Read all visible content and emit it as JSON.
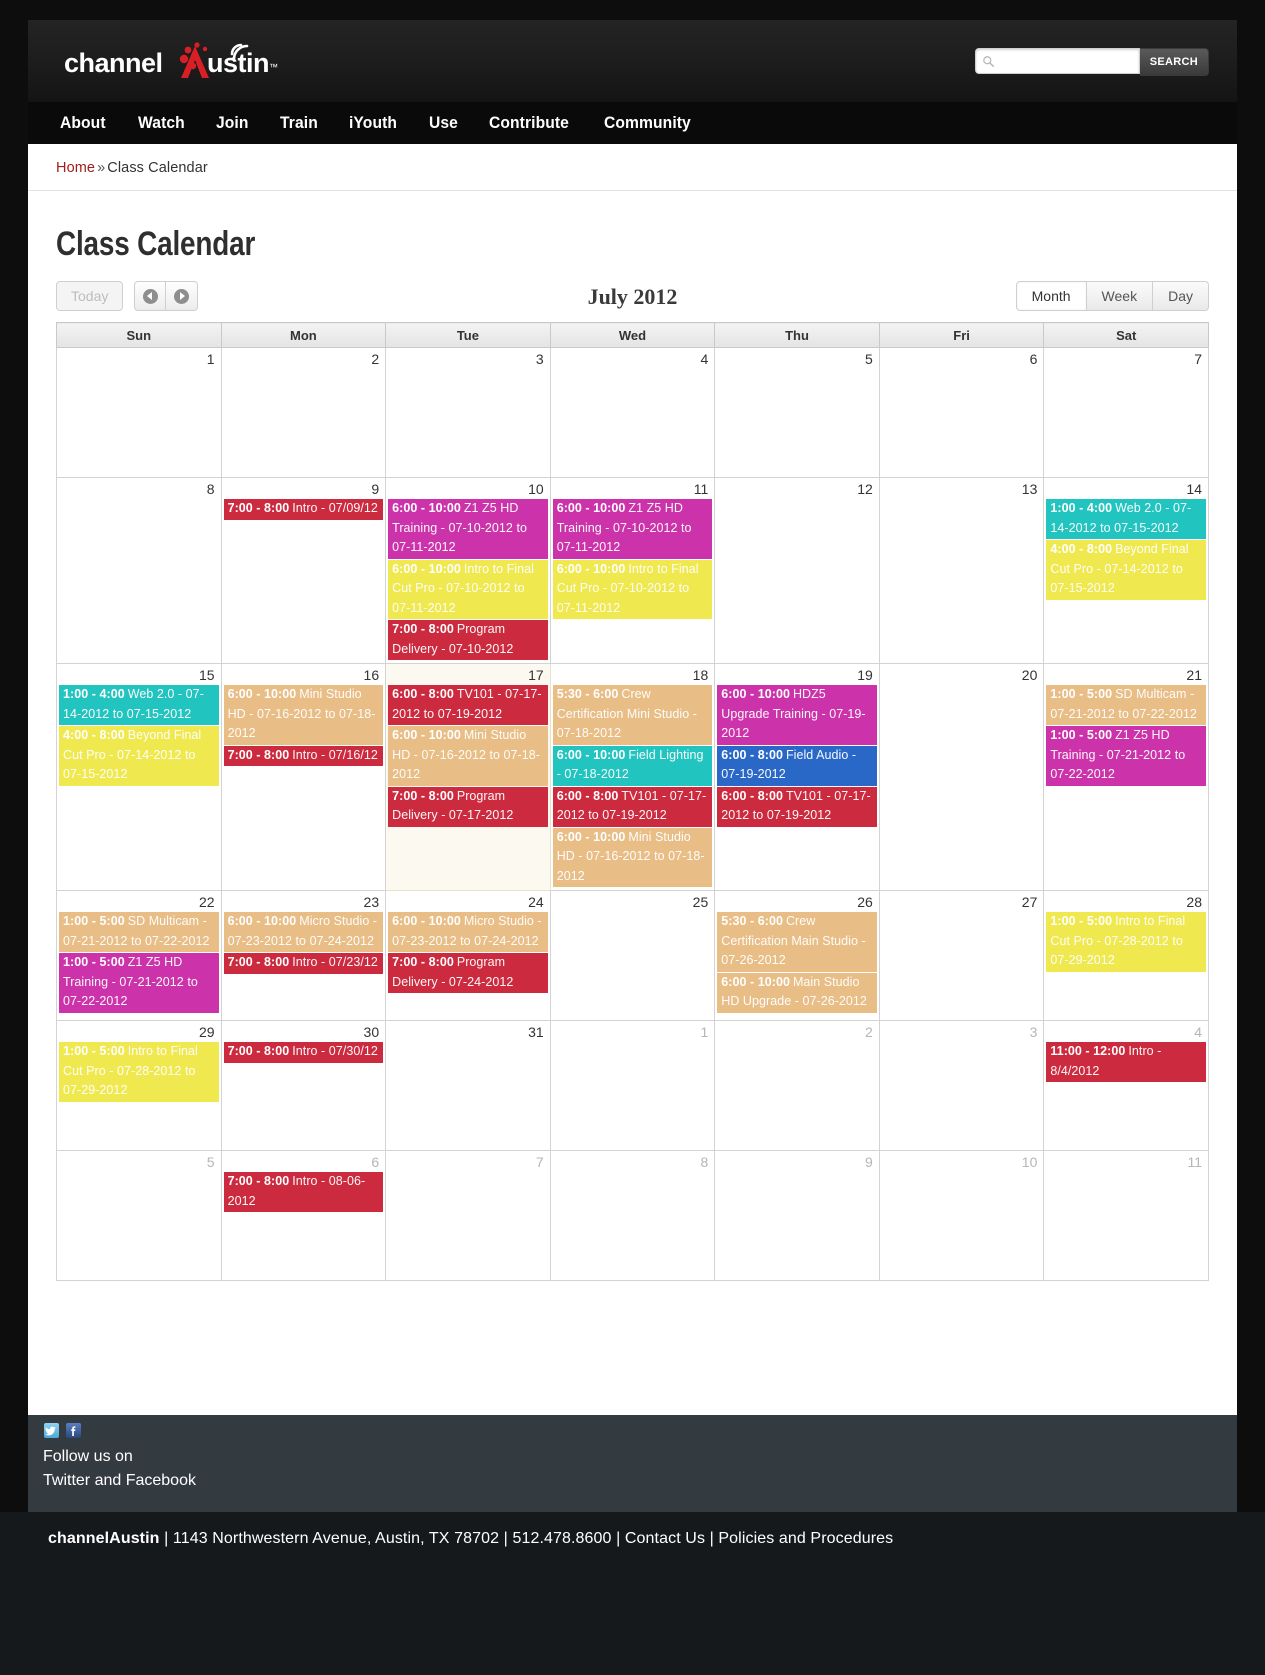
{
  "site": {
    "logo_text": "channelAustin",
    "logo_tm": "™"
  },
  "search": {
    "placeholder": "",
    "value": "",
    "button_label": "SEARCH",
    "icon": "search-icon"
  },
  "nav": {
    "items": [
      {
        "label": "About"
      },
      {
        "label": "Watch"
      },
      {
        "label": "Join"
      },
      {
        "label": "Train"
      },
      {
        "label": "iYouth"
      },
      {
        "label": "Use"
      },
      {
        "label": "Contribute"
      },
      {
        "label": "Community"
      }
    ]
  },
  "breadcrumb": {
    "home": "Home",
    "separator": "»",
    "current": "Class Calendar"
  },
  "page": {
    "title": "Class Calendar"
  },
  "toolbar": {
    "today_label": "Today",
    "prev_label": "◀",
    "next_label": "▶",
    "month_title": "July 2012",
    "views": [
      {
        "label": "Month",
        "active": true
      },
      {
        "label": "Week",
        "active": false
      },
      {
        "label": "Day",
        "active": false
      }
    ]
  },
  "calendar": {
    "weekday_headers": [
      "Sun",
      "Mon",
      "Tue",
      "Wed",
      "Thu",
      "Fri",
      "Sat"
    ],
    "colors": {
      "red": "#cc2b3f",
      "magenta": "#cc33aa",
      "yellow": "#efe84f",
      "teal": "#22c4c0",
      "tan": "#e8bd86",
      "blue": "#2a68c8"
    },
    "weeks": [
      {
        "days": [
          {
            "num": "1",
            "other": false,
            "today": false,
            "events": []
          },
          {
            "num": "2",
            "other": false,
            "today": false,
            "events": []
          },
          {
            "num": "3",
            "other": false,
            "today": false,
            "events": []
          },
          {
            "num": "4",
            "other": false,
            "today": false,
            "events": []
          },
          {
            "num": "5",
            "other": false,
            "today": false,
            "events": []
          },
          {
            "num": "6",
            "other": false,
            "today": false,
            "events": []
          },
          {
            "num": "7",
            "other": false,
            "today": false,
            "events": []
          }
        ]
      },
      {
        "days": [
          {
            "num": "8",
            "other": false,
            "today": false,
            "events": []
          },
          {
            "num": "9",
            "other": false,
            "today": false,
            "events": [
              {
                "time": "7:00 - 8:00",
                "title": "Intro - 07/09/12",
                "color": "red"
              }
            ]
          },
          {
            "num": "10",
            "other": false,
            "today": false,
            "events": [
              {
                "time": "6:00 - 10:00",
                "title": "Z1 Z5 HD Training - 07-10-2012 to 07-11-2012",
                "color": "magenta"
              },
              {
                "time": "6:00 - 10:00",
                "title": "Intro to Final Cut Pro - 07-10-2012 to 07-11-2012",
                "color": "yellow"
              },
              {
                "time": "7:00 - 8:00",
                "title": "Program Delivery - 07-10-2012",
                "color": "red"
              }
            ]
          },
          {
            "num": "11",
            "other": false,
            "today": false,
            "events": [
              {
                "time": "6:00 - 10:00",
                "title": "Z1 Z5 HD Training - 07-10-2012 to 07-11-2012",
                "color": "magenta"
              },
              {
                "time": "6:00 - 10:00",
                "title": "Intro to Final Cut Pro - 07-10-2012 to 07-11-2012",
                "color": "yellow"
              }
            ]
          },
          {
            "num": "12",
            "other": false,
            "today": false,
            "events": []
          },
          {
            "num": "13",
            "other": false,
            "today": false,
            "events": []
          },
          {
            "num": "14",
            "other": false,
            "today": false,
            "events": [
              {
                "time": "1:00 - 4:00",
                "title": "Web 2.0 - 07-14-2012 to 07-15-2012",
                "color": "teal"
              },
              {
                "time": "4:00 - 8:00",
                "title": "Beyond Final Cut Pro - 07-14-2012 to 07-15-2012",
                "color": "yellow"
              }
            ]
          }
        ]
      },
      {
        "days": [
          {
            "num": "15",
            "other": false,
            "today": false,
            "events": [
              {
                "time": "1:00 - 4:00",
                "title": "Web 2.0 - 07-14-2012 to 07-15-2012",
                "color": "teal"
              },
              {
                "time": "4:00 - 8:00",
                "title": "Beyond Final Cut Pro - 07-14-2012 to 07-15-2012",
                "color": "yellow"
              }
            ]
          },
          {
            "num": "16",
            "other": false,
            "today": false,
            "events": [
              {
                "time": "6:00 - 10:00",
                "title": "Mini Studio HD - 07-16-2012 to 07-18-2012",
                "color": "tan"
              },
              {
                "time": "7:00 - 8:00",
                "title": "Intro - 07/16/12",
                "color": "red"
              }
            ]
          },
          {
            "num": "17",
            "other": false,
            "today": true,
            "events": [
              {
                "time": "6:00 - 8:00",
                "title": "TV101 - 07-17-2012 to 07-19-2012",
                "color": "red"
              },
              {
                "time": "6:00 - 10:00",
                "title": "Mini Studio HD - 07-16-2012 to 07-18-2012",
                "color": "tan"
              },
              {
                "time": "7:00 - 8:00",
                "title": "Program Delivery - 07-17-2012",
                "color": "red"
              }
            ]
          },
          {
            "num": "18",
            "other": false,
            "today": false,
            "events": [
              {
                "time": "5:30 - 6:00",
                "title": "Crew Certification Mini Studio - 07-18-2012",
                "color": "tan"
              },
              {
                "time": "6:00 - 10:00",
                "title": "Field Lighting - 07-18-2012",
                "color": "teal"
              },
              {
                "time": "6:00 - 8:00",
                "title": "TV101 - 07-17-2012 to 07-19-2012",
                "color": "red"
              },
              {
                "time": "6:00 - 10:00",
                "title": "Mini Studio HD - 07-16-2012 to 07-18-2012",
                "color": "tan"
              }
            ]
          },
          {
            "num": "19",
            "other": false,
            "today": false,
            "events": [
              {
                "time": "6:00 - 10:00",
                "title": "HDZ5 Upgrade Training - 07-19-2012",
                "color": "magenta"
              },
              {
                "time": "6:00 - 8:00",
                "title": "Field Audio - 07-19-2012",
                "color": "blue"
              },
              {
                "time": "6:00 - 8:00",
                "title": "TV101 - 07-17-2012 to 07-19-2012",
                "color": "red"
              }
            ]
          },
          {
            "num": "20",
            "other": false,
            "today": false,
            "events": []
          },
          {
            "num": "21",
            "other": false,
            "today": false,
            "events": [
              {
                "time": "1:00 - 5:00",
                "title": "SD Multicam - 07-21-2012 to 07-22-2012",
                "color": "tan"
              },
              {
                "time": "1:00 - 5:00",
                "title": "Z1 Z5 HD Training - 07-21-2012 to 07-22-2012",
                "color": "magenta"
              }
            ]
          }
        ]
      },
      {
        "days": [
          {
            "num": "22",
            "other": false,
            "today": false,
            "events": [
              {
                "time": "1:00 - 5:00",
                "title": "SD Multicam - 07-21-2012 to 07-22-2012",
                "color": "tan"
              },
              {
                "time": "1:00 - 5:00",
                "title": "Z1 Z5 HD Training - 07-21-2012 to 07-22-2012",
                "color": "magenta"
              }
            ]
          },
          {
            "num": "23",
            "other": false,
            "today": false,
            "events": [
              {
                "time": "6:00 - 10:00",
                "title": "Micro Studio - 07-23-2012 to 07-24-2012",
                "color": "tan"
              },
              {
                "time": "7:00 - 8:00",
                "title": "Intro - 07/23/12",
                "color": "red"
              }
            ]
          },
          {
            "num": "24",
            "other": false,
            "today": false,
            "events": [
              {
                "time": "6:00 - 10:00",
                "title": "Micro Studio - 07-23-2012 to 07-24-2012",
                "color": "tan"
              },
              {
                "time": "7:00 - 8:00",
                "title": "Program Delivery - 07-24-2012",
                "color": "red"
              }
            ]
          },
          {
            "num": "25",
            "other": false,
            "today": false,
            "events": []
          },
          {
            "num": "26",
            "other": false,
            "today": false,
            "events": [
              {
                "time": "5:30 - 6:00",
                "title": "Crew Certification Main Studio - 07-26-2012",
                "color": "tan"
              },
              {
                "time": "6:00 - 10:00",
                "title": "Main Studio HD Upgrade - 07-26-2012",
                "color": "tan"
              }
            ]
          },
          {
            "num": "27",
            "other": false,
            "today": false,
            "events": []
          },
          {
            "num": "28",
            "other": false,
            "today": false,
            "events": [
              {
                "time": "1:00 - 5:00",
                "title": "Intro to Final Cut Pro - 07-28-2012 to 07-29-2012",
                "color": "yellow"
              }
            ]
          }
        ]
      },
      {
        "days": [
          {
            "num": "29",
            "other": false,
            "today": false,
            "events": [
              {
                "time": "1:00 - 5:00",
                "title": "Intro to Final Cut Pro - 07-28-2012 to 07-29-2012",
                "color": "yellow"
              }
            ]
          },
          {
            "num": "30",
            "other": false,
            "today": false,
            "events": [
              {
                "time": "7:00 - 8:00",
                "title": "Intro - 07/30/12",
                "color": "red"
              }
            ]
          },
          {
            "num": "31",
            "other": false,
            "today": false,
            "events": []
          },
          {
            "num": "1",
            "other": true,
            "today": false,
            "events": []
          },
          {
            "num": "2",
            "other": true,
            "today": false,
            "events": []
          },
          {
            "num": "3",
            "other": true,
            "today": false,
            "events": []
          },
          {
            "num": "4",
            "other": true,
            "today": false,
            "events": [
              {
                "time": "11:00 - 12:00",
                "title": "Intro - 8/4/2012",
                "color": "red"
              }
            ]
          }
        ]
      },
      {
        "days": [
          {
            "num": "5",
            "other": true,
            "today": false,
            "events": []
          },
          {
            "num": "6",
            "other": true,
            "today": false,
            "events": [
              {
                "time": "7:00 - 8:00",
                "title": "Intro - 08-06-2012",
                "color": "red"
              }
            ]
          },
          {
            "num": "7",
            "other": true,
            "today": false,
            "events": []
          },
          {
            "num": "8",
            "other": true,
            "today": false,
            "events": []
          },
          {
            "num": "9",
            "other": true,
            "today": false,
            "events": []
          },
          {
            "num": "10",
            "other": true,
            "today": false,
            "events": []
          },
          {
            "num": "11",
            "other": true,
            "today": false,
            "events": []
          }
        ]
      }
    ]
  },
  "social": {
    "line1": "Follow us on",
    "line2": "Twitter and Facebook",
    "twitter_icon": "twitter-icon",
    "facebook_icon": "facebook-icon"
  },
  "footer": {
    "org": "channelAustin",
    "sep": "|",
    "address": "1143 Northwestern Avenue, Austin, TX 78702",
    "phone": "512.478.8600",
    "contact": "Contact Us",
    "policies": "Policies and Procedures"
  }
}
